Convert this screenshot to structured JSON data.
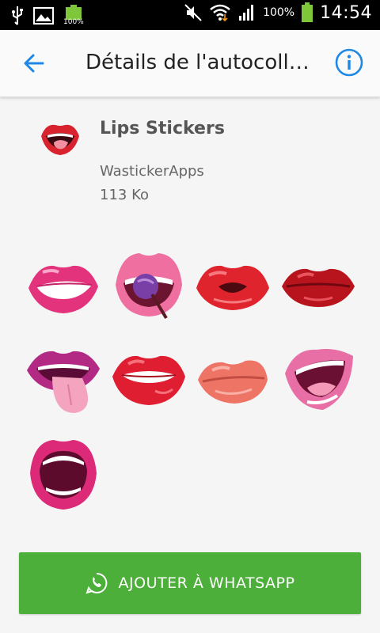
{
  "status_bar": {
    "battery_left_label": "100%",
    "battery_percent": "100%",
    "time": "14:54"
  },
  "app_bar": {
    "title": "Détails de l'autocoll…",
    "back_icon": "arrow-back-icon",
    "info_icon": "info-icon"
  },
  "pack": {
    "name": "Lips Stickers",
    "publisher": "WastickerApps",
    "size": "113 Ko"
  },
  "stickers": [
    {
      "name": "pink-smile-lips"
    },
    {
      "name": "lollipop-lips"
    },
    {
      "name": "red-pout-lips"
    },
    {
      "name": "dark-red-lips"
    },
    {
      "name": "tongue-out-lips"
    },
    {
      "name": "biting-lip"
    },
    {
      "name": "peach-kiss-lips"
    },
    {
      "name": "laughing-lips"
    },
    {
      "name": "open-mouth-lips"
    }
  ],
  "add_button": {
    "label": "AJOUTER À WHATSAPP",
    "icon": "whatsapp-icon",
    "color": "#4caf3a"
  },
  "colors": {
    "accent": "#1e88e5",
    "status_bar": "#000000"
  }
}
